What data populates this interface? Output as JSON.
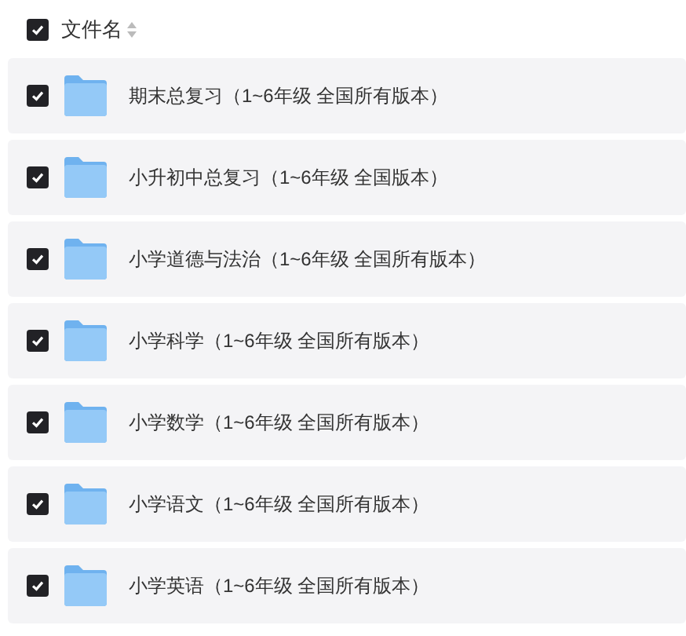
{
  "header": {
    "label": "文件名",
    "checked": true
  },
  "files": [
    {
      "name": "期末总复习（1~6年级 全国所有版本）",
      "checked": true
    },
    {
      "name": "小升初中总复习（1~6年级 全国版本）",
      "checked": true
    },
    {
      "name": "小学道德与法治（1~6年级 全国所有版本）",
      "checked": true
    },
    {
      "name": "小学科学（1~6年级 全国所有版本）",
      "checked": true
    },
    {
      "name": "小学数学（1~6年级 全国所有版本）",
      "checked": true
    },
    {
      "name": "小学语文（1~6年级 全国所有版本）",
      "checked": true
    },
    {
      "name": "小学英语（1~6年级 全国所有版本）",
      "checked": true
    }
  ]
}
